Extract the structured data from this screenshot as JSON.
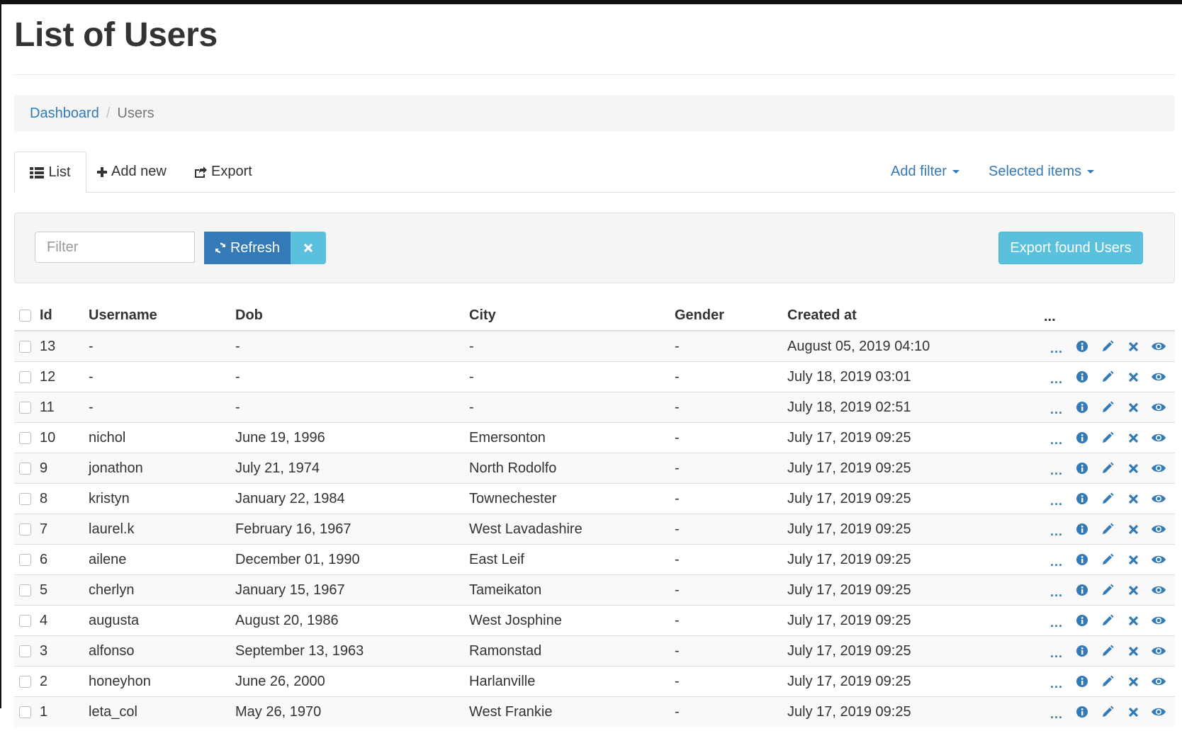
{
  "page": {
    "title": "List of Users"
  },
  "breadcrumb": {
    "link": "Dashboard",
    "separator": "/",
    "current": "Users"
  },
  "tabs": {
    "list": "List",
    "add_new": "Add new",
    "export": "Export",
    "add_filter": "Add filter",
    "selected_items": "Selected items"
  },
  "filter": {
    "placeholder": "Filter",
    "value": "",
    "refresh_label": "Refresh",
    "export_label": "Export found Users"
  },
  "table": {
    "headers": {
      "id": "Id",
      "username": "Username",
      "dob": "Dob",
      "city": "City",
      "gender": "Gender",
      "created_at": "Created at",
      "actions": "..."
    },
    "action_icons": [
      "more-icon",
      "info-icon",
      "pencil-icon",
      "close-icon",
      "eye-icon"
    ],
    "rows": [
      {
        "id": "13",
        "username": "-",
        "dob": "-",
        "city": "-",
        "gender": "-",
        "created_at": "August 05, 2019 04:10",
        "more": "..."
      },
      {
        "id": "12",
        "username": "-",
        "dob": "-",
        "city": "-",
        "gender": "-",
        "created_at": "July 18, 2019 03:01",
        "more": "..."
      },
      {
        "id": "11",
        "username": "-",
        "dob": "-",
        "city": "-",
        "gender": "-",
        "created_at": "July 18, 2019 02:51",
        "more": "..."
      },
      {
        "id": "10",
        "username": "nichol",
        "dob": "June 19, 1996",
        "city": "Emersonton",
        "gender": "-",
        "created_at": "July 17, 2019 09:25",
        "more": "..."
      },
      {
        "id": "9",
        "username": "jonathon",
        "dob": "July 21, 1974",
        "city": "North Rodolfo",
        "gender": "-",
        "created_at": "July 17, 2019 09:25",
        "more": "..."
      },
      {
        "id": "8",
        "username": "kristyn",
        "dob": "January 22, 1984",
        "city": "Townechester",
        "gender": "-",
        "created_at": "July 17, 2019 09:25",
        "more": "..."
      },
      {
        "id": "7",
        "username": "laurel.k",
        "dob": "February 16, 1967",
        "city": "West Lavadashire",
        "gender": "-",
        "created_at": "July 17, 2019 09:25",
        "more": "..."
      },
      {
        "id": "6",
        "username": "ailene",
        "dob": "December 01, 1990",
        "city": "East Leif",
        "gender": "-",
        "created_at": "July 17, 2019 09:25",
        "more": "..."
      },
      {
        "id": "5",
        "username": "cherlyn",
        "dob": "January 15, 1967",
        "city": "Tameikaton",
        "gender": "-",
        "created_at": "July 17, 2019 09:25",
        "more": "..."
      },
      {
        "id": "4",
        "username": "augusta",
        "dob": "August 20, 1986",
        "city": "West Josphine",
        "gender": "-",
        "created_at": "July 17, 2019 09:25",
        "more": "..."
      },
      {
        "id": "3",
        "username": "alfonso",
        "dob": "September 13, 1963",
        "city": "Ramonstad",
        "gender": "-",
        "created_at": "July 17, 2019 09:25",
        "more": "..."
      },
      {
        "id": "2",
        "username": "honeyhon",
        "dob": "June 26, 2000",
        "city": "Harlanville",
        "gender": "-",
        "created_at": "July 17, 2019 09:25",
        "more": "..."
      },
      {
        "id": "1",
        "username": "leta_col",
        "dob": "May 26, 1970",
        "city": "West Frankie",
        "gender": "-",
        "created_at": "July 17, 2019 09:25",
        "more": "..."
      }
    ]
  },
  "colors": {
    "primary": "#337ab7",
    "info": "#5bc0de",
    "text": "#333333"
  }
}
